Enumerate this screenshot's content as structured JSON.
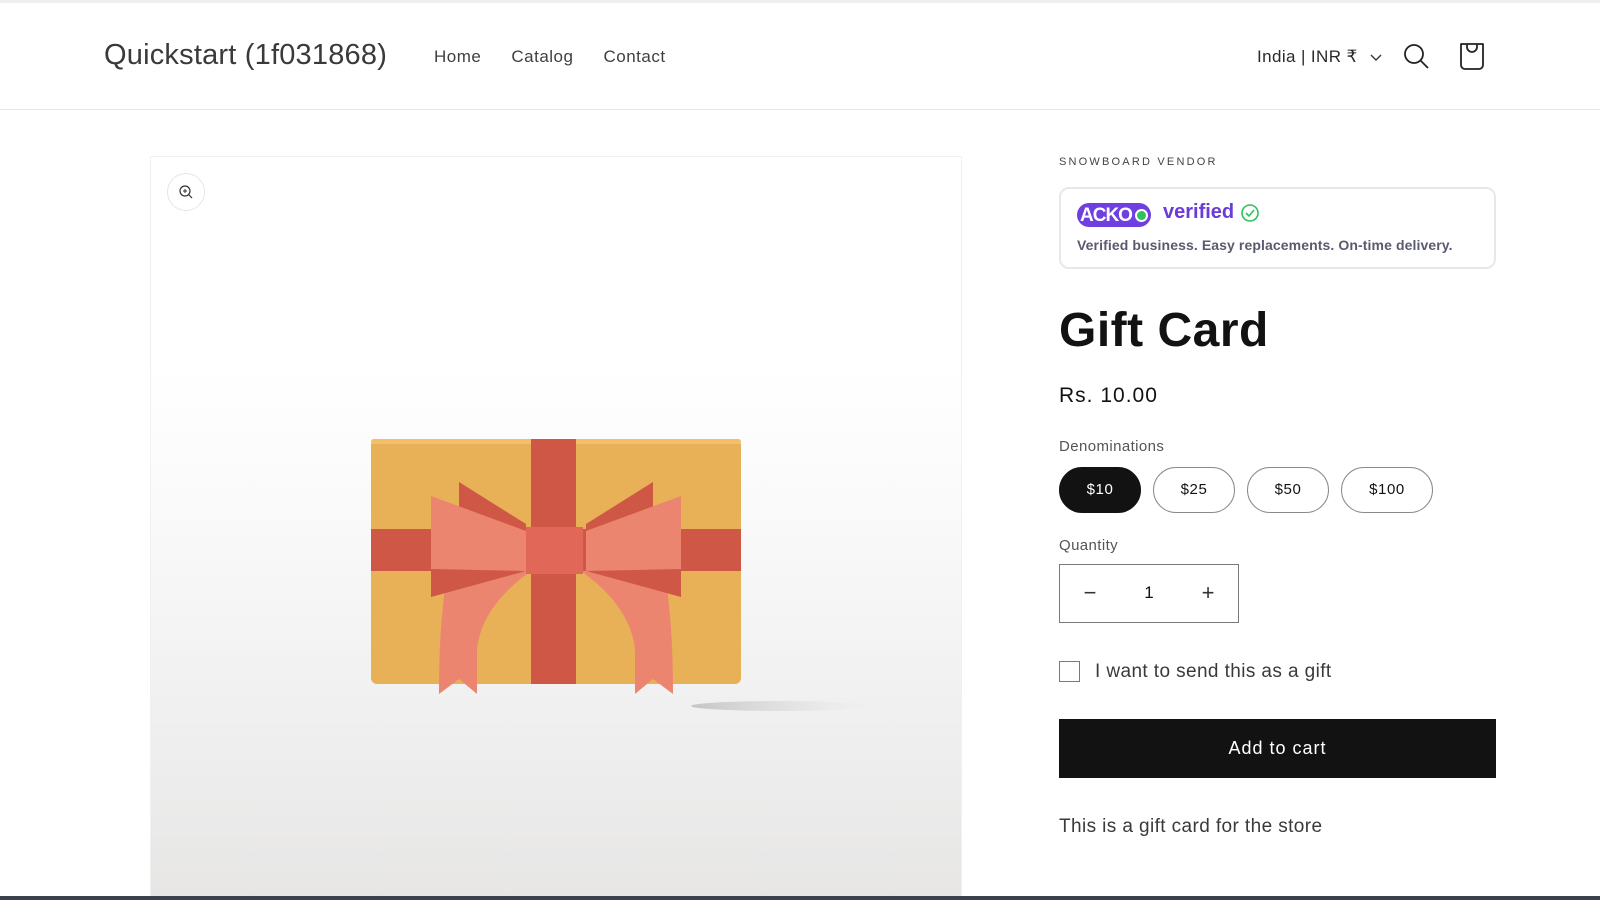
{
  "header": {
    "store_name": "Quickstart (1f031868)",
    "nav": [
      "Home",
      "Catalog",
      "Contact"
    ],
    "locale": "India | INR ₹",
    "icons": {
      "locale_dropdown": "chevron-down-icon",
      "search": "search-icon",
      "cart": "cart-icon"
    }
  },
  "media": {
    "zoom_icon": "zoom-in-icon",
    "image_alt": "Gift card illustration with red ribbon bow",
    "colors": {
      "card": "#E8B057",
      "ribbon": "#CF5746",
      "bow": "#EC8570"
    }
  },
  "product": {
    "vendor": "SNOWBOARD VENDOR",
    "badge": {
      "brand": "ACKO",
      "verified_text": "verified",
      "subtitle": "Verified business. Easy replacements. On-time delivery.",
      "brand_color": "#6F3FE0",
      "check_color": "#2FC15A"
    },
    "title": "Gift Card",
    "price": "Rs. 10.00",
    "denominations_label": "Denominations",
    "denominations": [
      {
        "label": "$10",
        "selected": true
      },
      {
        "label": "$25",
        "selected": false
      },
      {
        "label": "$50",
        "selected": false
      },
      {
        "label": "$100",
        "selected": false
      }
    ],
    "quantity_label": "Quantity",
    "quantity": {
      "value": "1",
      "decrement": "−",
      "increment": "+"
    },
    "gift_checkbox": {
      "label": "I want to send this as a gift",
      "checked": false
    },
    "add_to_cart": "Add to cart",
    "description": "This is a gift card for the store"
  }
}
